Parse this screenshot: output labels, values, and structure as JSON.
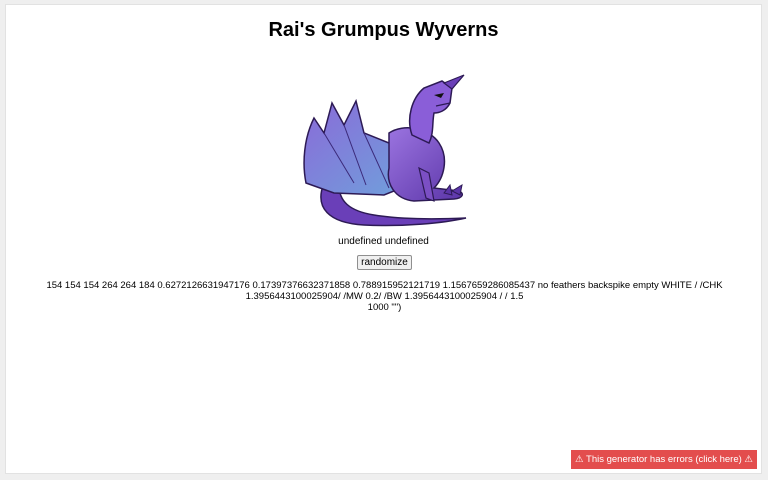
{
  "page": {
    "title": "Rai's Grumpus Wyverns",
    "name_line": "undefined undefined"
  },
  "controls": {
    "randomize_label": "randomize"
  },
  "output": {
    "line1": "154 154 154 264 264 184 0.6272126631947176 0.17397376632371858 0.788915952121719 1.1567659286085437 no feathers backspike empty WHITE / /CHK",
    "line2": "1.3956443100025904/ /MW 0.2/ /BW 1.3956443100025904 / / 1.5",
    "line3": "1000 \"\")"
  },
  "error_banner": {
    "text": "⚠ This generator has errors (click here) ⚠"
  },
  "colors": {
    "error_banner_bg": "#e34d4d",
    "dragon_main": "#7b4fc4",
    "dragon_wing": "#6a8fd8"
  },
  "icons": {
    "creature": "purple-wyvern-image"
  }
}
